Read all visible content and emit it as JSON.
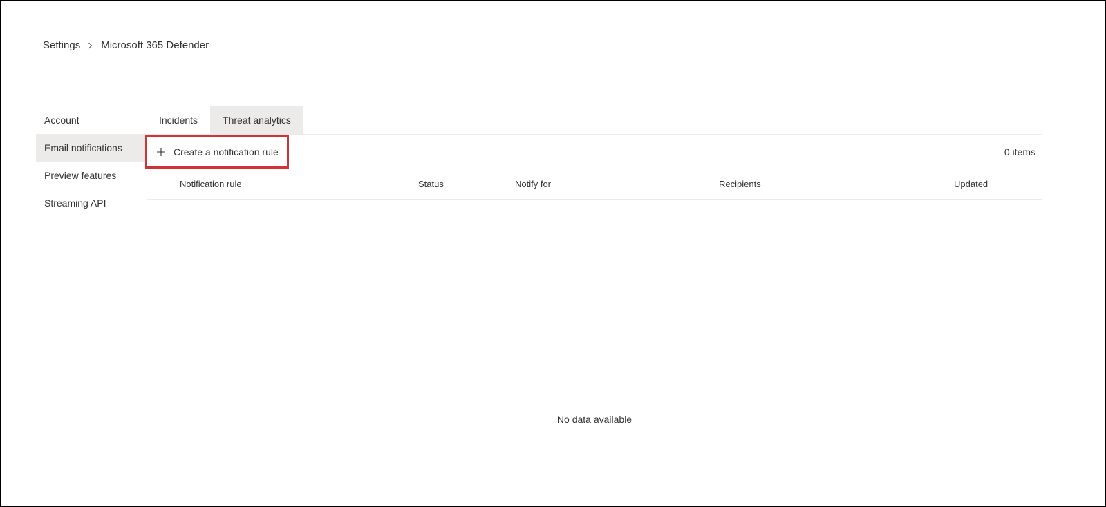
{
  "breadcrumb": {
    "parent": "Settings",
    "current": "Microsoft 365 Defender"
  },
  "sidebar": {
    "items": [
      {
        "label": "Account",
        "active": false
      },
      {
        "label": "Email notifications",
        "active": true
      },
      {
        "label": "Preview features",
        "active": false
      },
      {
        "label": "Streaming API",
        "active": false
      }
    ]
  },
  "tabs": [
    {
      "label": "Incidents",
      "active": false
    },
    {
      "label": "Threat analytics",
      "active": true
    }
  ],
  "toolbar": {
    "create_label": "Create a notification rule",
    "item_count": "0 items"
  },
  "table": {
    "columns": [
      "Notification rule",
      "Status",
      "Notify for",
      "Recipients",
      "Updated"
    ],
    "empty_message": "No data available"
  }
}
